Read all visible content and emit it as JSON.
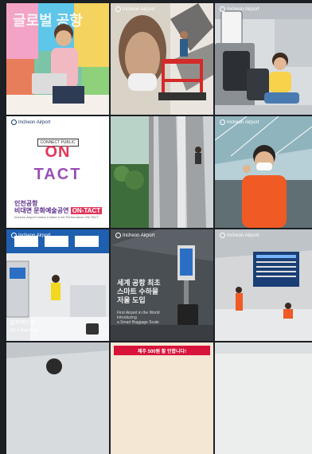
{
  "feed": {
    "brand": "Incheon Airport",
    "tiles": [
      {
        "id": "worker-mural"
      },
      {
        "id": "painter-mural"
      },
      {
        "id": "child-luggage"
      },
      {
        "id": "ontact",
        "label": "CONNECT PUBLIC",
        "on": "ON",
        "tact": "TACT",
        "ko1": "인천공항",
        "ko2_prefix": "비대면 문화예술공연",
        "ko2_highlight": "ON-TACT",
        "en": "Incheon Airport Untact Culture & Art Performance ON-TACT"
      },
      {
        "id": "escalator"
      },
      {
        "id": "masked-man"
      },
      {
        "id": "bag-drop",
        "ko": "셀프백드랍",
        "en": "SELF Bag Drop"
      },
      {
        "id": "baggage-scale",
        "ko": "세계 공항 최초\n스마트 수하물\n저울 도입",
        "en": "First Airport in the World\nIntroducing\na Smart Baggage Scale"
      },
      {
        "id": "departure-board"
      },
      {
        "id": "partial-1"
      },
      {
        "id": "promo",
        "banner": "제주 500원 할 인합니다!"
      },
      {
        "id": "partial-3"
      }
    ]
  }
}
